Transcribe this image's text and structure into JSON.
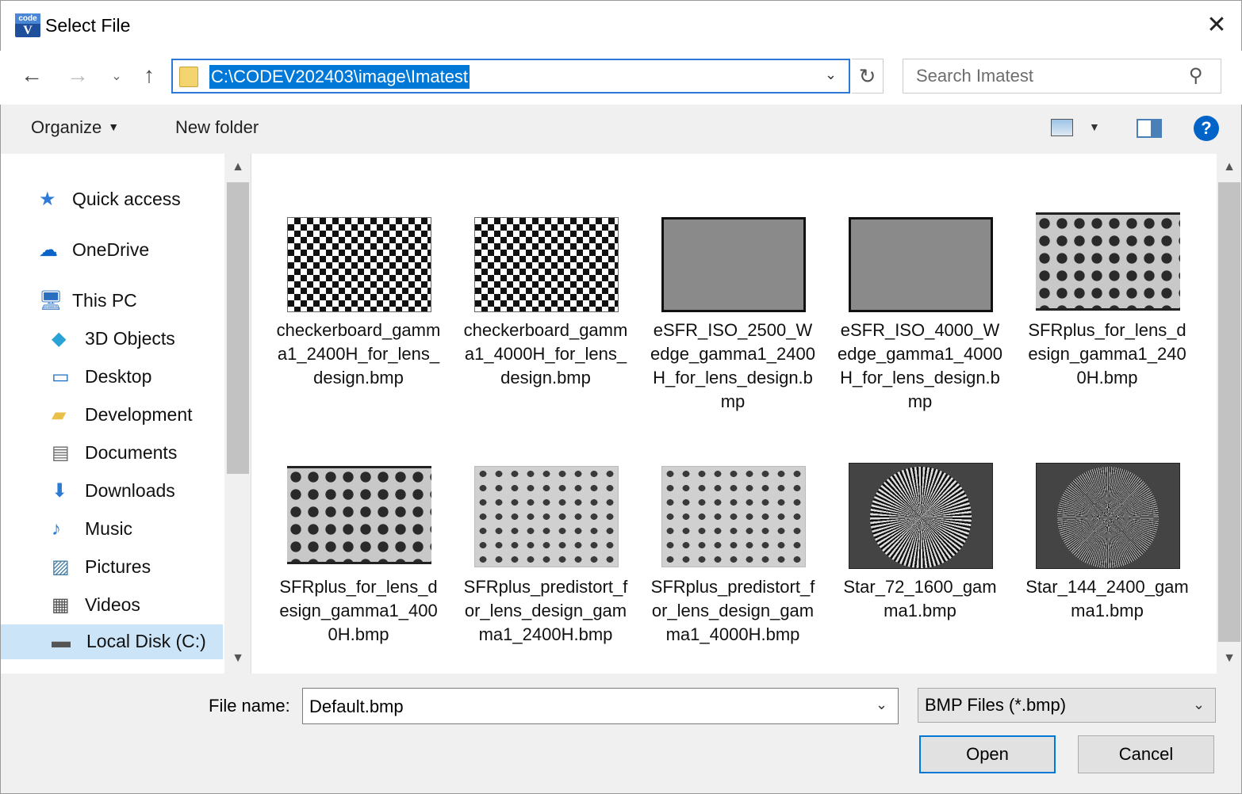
{
  "window": {
    "title": "Select File",
    "close_label": "✕",
    "app_icon_top": "code",
    "app_icon_bottom": "V"
  },
  "address_bar": {
    "path": "C:\\CODEV202403\\image\\Imatest"
  },
  "search": {
    "placeholder": "Search Imatest"
  },
  "toolbar": {
    "organize_label": "Organize",
    "new_folder_label": "New folder",
    "help_label": "?"
  },
  "navigation": {
    "items": [
      {
        "label": "Quick access",
        "icon": "star-icon",
        "indent": 0
      },
      {
        "label": "OneDrive",
        "icon": "cloud-icon",
        "indent": 0
      },
      {
        "label": "This PC",
        "icon": "computer-icon",
        "indent": 0
      },
      {
        "label": "3D Objects",
        "icon": "cube-icon",
        "indent": 1
      },
      {
        "label": "Desktop",
        "icon": "desktop-icon",
        "indent": 1
      },
      {
        "label": "Development",
        "icon": "folder-icon",
        "indent": 1
      },
      {
        "label": "Documents",
        "icon": "document-icon",
        "indent": 1
      },
      {
        "label": "Downloads",
        "icon": "download-icon",
        "indent": 1
      },
      {
        "label": "Music",
        "icon": "music-icon",
        "indent": 1
      },
      {
        "label": "Pictures",
        "icon": "picture-icon",
        "indent": 1
      },
      {
        "label": "Videos",
        "icon": "video-icon",
        "indent": 1
      },
      {
        "label": "Local Disk (C:)",
        "icon": "drive-icon",
        "indent": 1,
        "selected": true
      }
    ]
  },
  "files": [
    {
      "name": "checkerboard_gamma1_2400H_for_lens_design.bmp",
      "thumb": "checker"
    },
    {
      "name": "checkerboard_gamma1_4000H_for_lens_design.bmp",
      "thumb": "checker"
    },
    {
      "name": "eSFR_ISO_2500_Wedge_gamma1_2400H_for_lens_design.bmp",
      "thumb": "esfr"
    },
    {
      "name": "eSFR_ISO_4000_Wedge_gamma1_4000H_for_lens_design.bmp",
      "thumb": "esfr"
    },
    {
      "name": "SFRplus_for_lens_design_gamma1_2400H.bmp",
      "thumb": "sfr"
    },
    {
      "name": "SFRplus_for_lens_design_gamma1_4000H.bmp",
      "thumb": "sfr"
    },
    {
      "name": "SFRplus_predistort_for_lens_design_gamma1_2400H.bmp",
      "thumb": "predist"
    },
    {
      "name": "SFRplus_predistort_for_lens_design_gamma1_4000H.bmp",
      "thumb": "predist"
    },
    {
      "name": "Star_72_1600_gamma1.bmp",
      "thumb": "star"
    },
    {
      "name": "Star_144_2400_gamma1.bmp",
      "thumb": "star2"
    }
  ],
  "bottom": {
    "file_name_label": "File name:",
    "file_name_value": "Default.bmp",
    "file_type_value": "BMP Files (*.bmp)",
    "open_label": "Open",
    "cancel_label": "Cancel"
  }
}
